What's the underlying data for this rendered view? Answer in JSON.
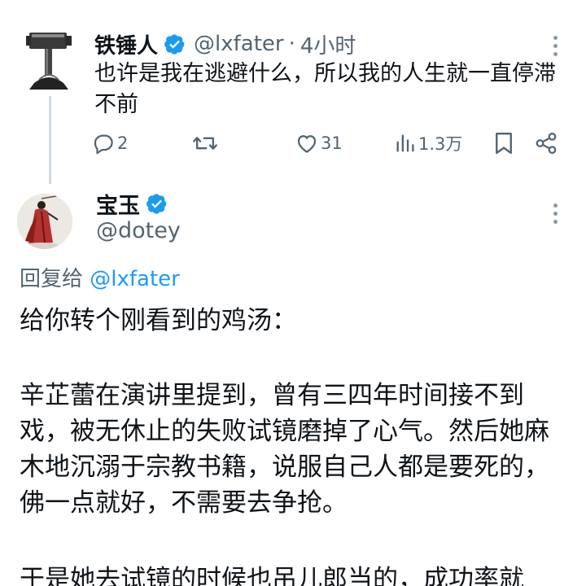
{
  "parent_tweet": {
    "display_name": "铁锤人",
    "handle": "@lxfater",
    "separator": "·",
    "time": "4小时",
    "text": "也许是我在逃避什么，所以我的人生就一直停滞不前",
    "actions": {
      "reply_count": "2",
      "retweet_count": "",
      "like_count": "31",
      "view_count": "1.3万"
    }
  },
  "reply_tweet": {
    "display_name": "宝玉",
    "handle": "@dotey",
    "reply_to_prefix": "回复给",
    "reply_to_handle": "@lxfater",
    "intro": "给你转个刚看到的鸡汤：",
    "paragraph1": "辛芷蕾在演讲里提到，曾有三四年时间接不到戏，被无休止的失败试镜磨掉了心气。然后她麻木地沉溺于宗教书籍，说服自己人都是要死的，佛一点就好，不需要去争抢。",
    "paragraph2": "于是她去试镜的时候也吊儿郎当的，成功率就"
  },
  "colors": {
    "verified_blue": "#1d9bf0",
    "text_primary": "#0f1419",
    "text_secondary": "#536471",
    "thread_line": "#cfd9de"
  }
}
